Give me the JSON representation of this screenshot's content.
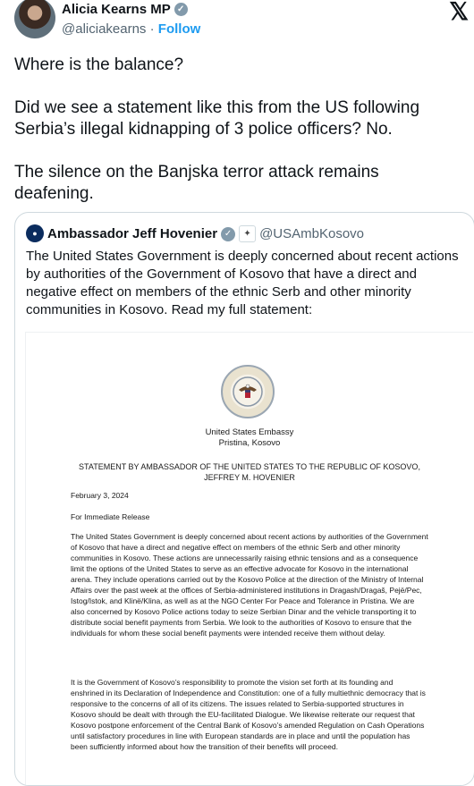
{
  "author": {
    "name": "Alicia Kearns MP",
    "handle": "@aliciakearns",
    "separator": "·",
    "follow_label": "Follow"
  },
  "tweet": {
    "paragraphs": [
      "Where is the balance?",
      "Did we see a statement like this from the US following Serbia’s illegal kidnapping of 3 police officers? No.",
      "The silence on the Banjska terror attack remains deafening."
    ]
  },
  "quote": {
    "name": "Ambassador Jeff Hovenier",
    "handle": "@USAmbKosovo",
    "text": "The United States Government is deeply concerned about recent actions by authorities of the Government of Kosovo that have a direct and negative effect on members of the ethnic Serb and other minority communities in Kosovo. Read my full statement:"
  },
  "document": {
    "embassy_line1": "United States Embassy",
    "embassy_line2": "Pristina, Kosovo",
    "statement_title": "STATEMENT BY AMBASSADOR OF THE UNITED STATES TO THE REPUBLIC OF KOSOVO, JEFFREY M. HOVENIER",
    "date": "February 3, 2024",
    "release": "For Immediate Release",
    "paragraph1": "The United States Government is deeply concerned about recent actions by authorities of the Government of Kosovo that have a direct and negative effect on members of the ethnic Serb and other minority communities in Kosovo. These actions are unnecessarily raising ethnic tensions and as a consequence limit the options of the United States to serve as an effective advocate for Kosovo in the international arena. They include operations carried out by the Kosovo Police at the direction of the Ministry of Internal Affairs over the past week at the offices of Serbia-administered institutions in Dragash/Dragaš, Pejë/Pec, Istog/Istok, and Klinë/Klina, as well as at the NGO Center For Peace and Tolerance in Pristina. We are also concerned by Kosovo Police actions today to seize Serbian Dinar and the vehicle transporting it to distribute social benefit payments from Serbia. We look to the authorities of Kosovo to ensure that the individuals for whom these social benefit payments were intended receive them without delay.",
    "paragraph2": "It is the Government of Kosovo’s responsibility to promote the vision set forth at its founding and enshrined in its Declaration of Independence and Constitution: one of a fully multiethnic democracy that is responsive to the concerns of all of its citizens. The issues related to Serbia-supported structures in Kosovo should be dealt with through the EU-facilitated Dialogue. We likewise reiterate our request that Kosovo postpone enforcement of the Central Bank of Kosovo’s amended Regulation on Cash Operations until satisfactory procedures in line with European standards are in place and until the population has been sufficiently informed about how the transition of their benefits will proceed."
  },
  "colors": {
    "link": "#1d9bf0",
    "muted": "#536471",
    "border": "#cfd9de"
  },
  "icons": [
    "avatar",
    "verified-badge-icon",
    "x-logo-icon",
    "embassy-seal-icon"
  ]
}
